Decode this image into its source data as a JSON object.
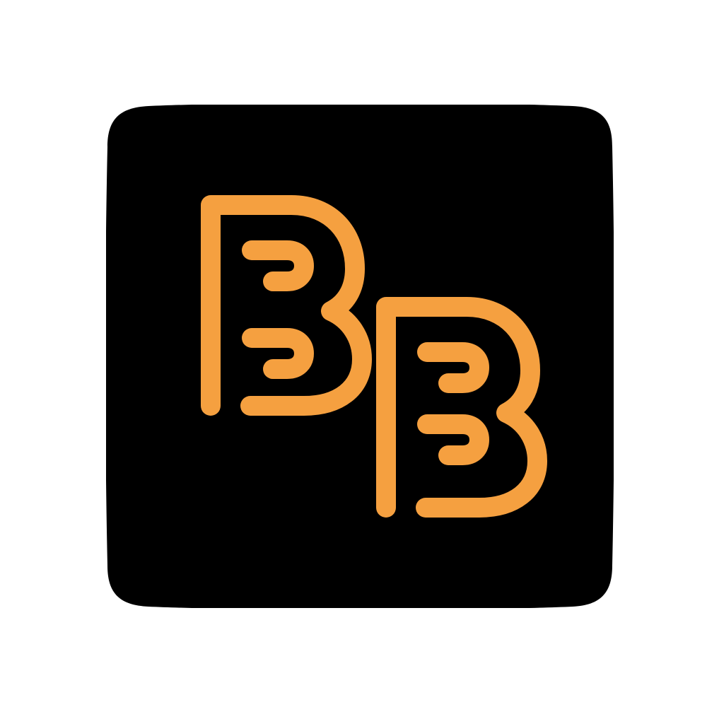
{
  "captions": {
    "top": "",
    "bottom": ""
  },
  "app_icon": {
    "icon_name": "bb-monogram-icon",
    "background_color": "#000000",
    "glyph_color": "#F5A040",
    "letters": [
      "B",
      "B"
    ]
  }
}
